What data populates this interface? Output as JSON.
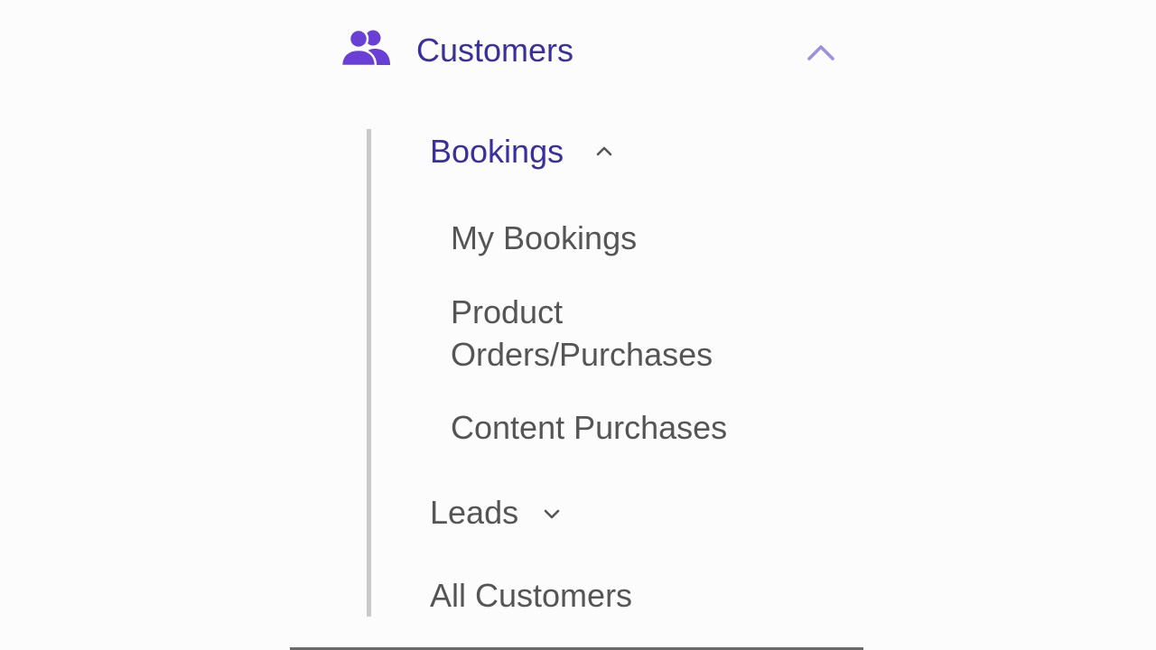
{
  "colors": {
    "accent": "#3a2f9e",
    "icon_accent": "#6a3fd6",
    "chevron_muted": "#9b8fe0",
    "text_muted": "#555555",
    "guide_line": "#c9c9c9",
    "background": "#fcfcfc"
  },
  "nav": {
    "section": {
      "icon": "users-icon",
      "title": "Customers",
      "expanded": true,
      "chevron": "chevron-up-icon"
    },
    "groups": [
      {
        "label": "Bookings",
        "expanded": true,
        "chevron": "chevron-up-icon",
        "items": [
          {
            "label": "My Bookings"
          },
          {
            "label": "Product Orders/Purchases"
          },
          {
            "label": "Content Purchases"
          }
        ]
      },
      {
        "label": "Leads",
        "expanded": false,
        "chevron": "chevron-down-icon"
      }
    ],
    "all_customers": {
      "label": "All Customers"
    }
  }
}
